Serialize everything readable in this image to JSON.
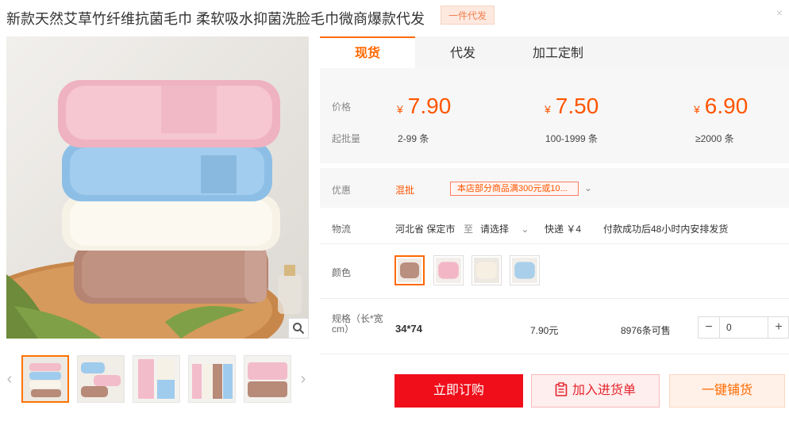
{
  "header": {
    "title": "新款天然艾草竹纤维抗菌毛巾 柔软吸水抑菌洗脸毛巾微商爆款代发",
    "badge": "一件代发",
    "close": "×"
  },
  "tabs": [
    {
      "label": "现货",
      "active": true
    },
    {
      "label": "代发",
      "active": false
    },
    {
      "label": "加工定制",
      "active": false
    }
  ],
  "pricing": {
    "price_label": "价格",
    "moq_label": "起批量",
    "currency": "¥",
    "tiers": [
      {
        "price": "7.90",
        "range": "2-99 条"
      },
      {
        "price": "7.50",
        "range": "100-1999 条"
      },
      {
        "price": "6.90",
        "range": "≥2000 条"
      }
    ]
  },
  "promo": {
    "label": "优惠",
    "tag": "混批",
    "coupon": "本店部分商品满300元或10..."
  },
  "logistics": {
    "label": "物流",
    "origin": "河北省 保定市",
    "to": "至",
    "dest": "请选择",
    "shipping": "快递 ￥4",
    "note": "付款成功后48小时内安排发货"
  },
  "color": {
    "label": "颜色",
    "swatches": [
      "#b98f80",
      "#f3b6c6",
      "#f3e6d8",
      "#a9cfea"
    ]
  },
  "spec": {
    "label": "规格（长*宽cm）",
    "size": "34*74",
    "price": "7.90元",
    "stock": "8976条可售",
    "minus": "−",
    "qty": "0",
    "plus": "+"
  },
  "actions": {
    "buy": "立即订购",
    "cart": "加入进货单",
    "distribute": "一键铺货"
  },
  "colors": {
    "accent": "#ff6a00",
    "price": "#ff5500",
    "buy_button": "#ef0e1a"
  }
}
